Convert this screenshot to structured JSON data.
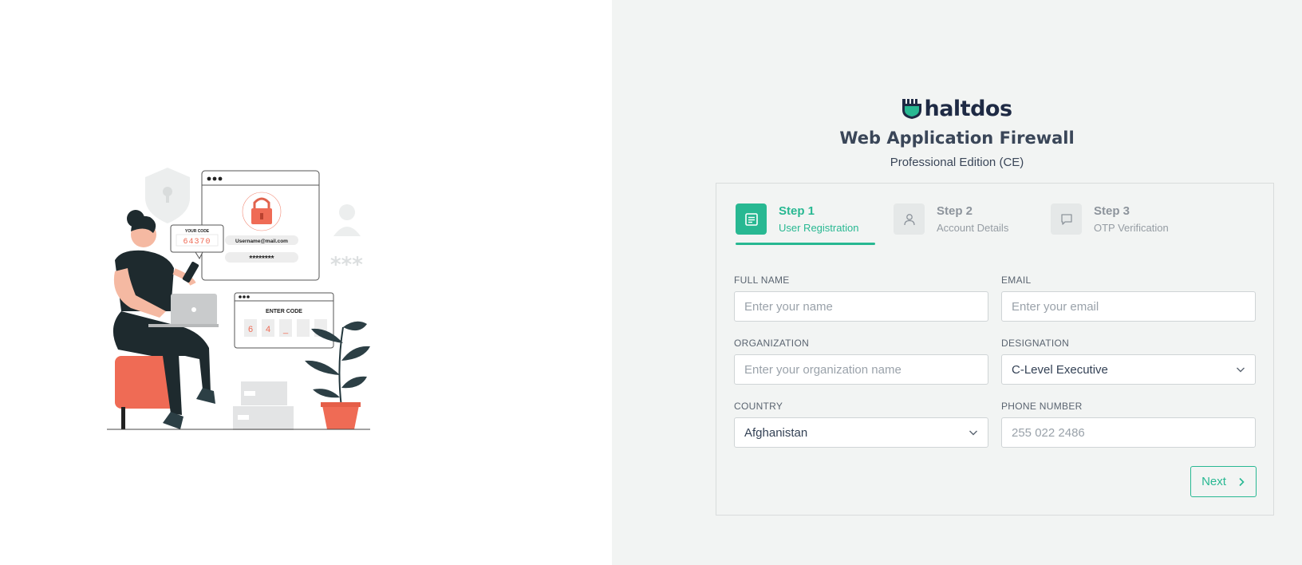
{
  "brand": {
    "logo_text": "haltdos",
    "app_title": "Web Application Firewall",
    "edition": "Professional Edition (CE)",
    "accent_color": "#28b892"
  },
  "illustration": {
    "code_label": "YOUR CODE",
    "code_value": "64370",
    "username": "Username@mail.com",
    "password_mask": "********",
    "enter_code_label": "ENTER CODE",
    "entered_digits": [
      "6",
      "4",
      "_",
      "",
      ""
    ],
    "asterisks": "***"
  },
  "stepper": {
    "steps": [
      {
        "title": "Step 1",
        "subtitle": "User Registration",
        "icon": "document-icon",
        "active": true
      },
      {
        "title": "Step 2",
        "subtitle": "Account Details",
        "icon": "user-icon",
        "active": false
      },
      {
        "title": "Step 3",
        "subtitle": "OTP Verification",
        "icon": "chat-icon",
        "active": false
      }
    ]
  },
  "form": {
    "full_name": {
      "label": "FULL NAME",
      "placeholder": "Enter your name",
      "value": ""
    },
    "email": {
      "label": "EMAIL",
      "placeholder": "Enter your email",
      "value": ""
    },
    "organization": {
      "label": "ORGANIZATION",
      "placeholder": "Enter your organization name",
      "value": ""
    },
    "designation": {
      "label": "DESIGNATION",
      "value": "C-Level Executive"
    },
    "country": {
      "label": "COUNTRY",
      "value": "Afghanistan"
    },
    "phone": {
      "label": "PHONE NUMBER",
      "placeholder": "255 022 2486",
      "value": ""
    }
  },
  "next_button": {
    "label": "Next",
    "icon": "chevron-right-icon"
  }
}
